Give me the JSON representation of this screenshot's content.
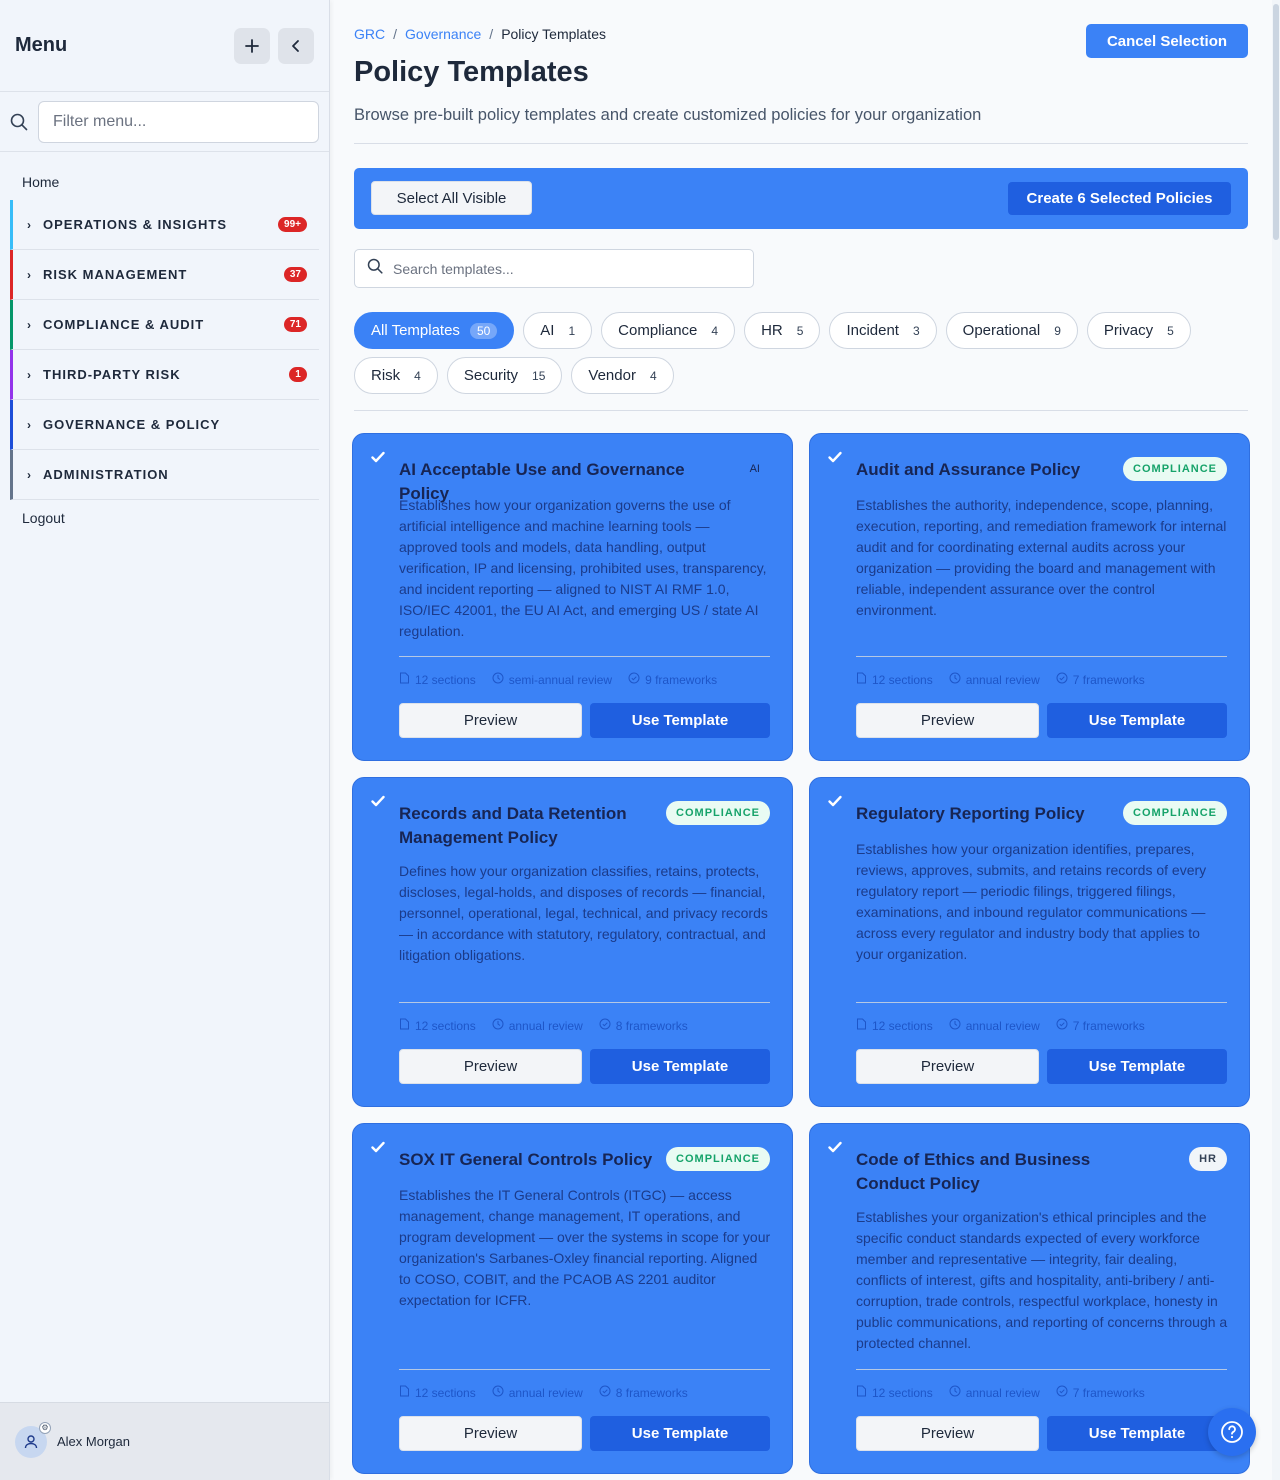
{
  "sidebar": {
    "title": "Menu",
    "add_icon": "plus-icon",
    "collapse_icon": "chevron-left-icon",
    "filter_placeholder": "Filter menu...",
    "home": "Home",
    "sections": [
      {
        "label": "OPERATIONS & INSIGHTS",
        "badge": "99+",
        "color": "#38bdf8"
      },
      {
        "label": "RISK MANAGEMENT",
        "badge": "37",
        "color": "#dc2626"
      },
      {
        "label": "COMPLIANCE & AUDIT",
        "badge": "71",
        "color": "#059669"
      },
      {
        "label": "THIRD-PARTY RISK",
        "badge": "1",
        "color": "#9333ea"
      },
      {
        "label": "GOVERNANCE & POLICY",
        "badge": "",
        "color": "#1d4ed8"
      },
      {
        "label": "ADMINISTRATION",
        "badge": "",
        "color": "#64748b"
      }
    ],
    "logout": "Logout",
    "user_name": "Alex Morgan"
  },
  "breadcrumb": {
    "items": [
      "GRC",
      "Governance"
    ],
    "sep": "/",
    "current": "Policy Templates"
  },
  "header": {
    "cancel_label": "Cancel Selection",
    "title": "Policy Templates",
    "subtitle": "Browse pre-built policy templates and create customized policies for your organization"
  },
  "selection": {
    "select_all_label": "Select All Visible",
    "create_label": "Create 6 Selected Policies"
  },
  "search": {
    "placeholder": "Search templates..."
  },
  "filters": [
    {
      "label": "All Templates",
      "count": "50",
      "active": true
    },
    {
      "label": "AI",
      "count": "1"
    },
    {
      "label": "Compliance",
      "count": "4"
    },
    {
      "label": "HR",
      "count": "5"
    },
    {
      "label": "Incident",
      "count": "3"
    },
    {
      "label": "Operational",
      "count": "9"
    },
    {
      "label": "Privacy",
      "count": "5"
    },
    {
      "label": "Risk",
      "count": "4"
    },
    {
      "label": "Security",
      "count": "15"
    },
    {
      "label": "Vendor",
      "count": "4"
    }
  ],
  "cards": [
    {
      "title": "AI Acceptable Use and Governance Policy",
      "tag": "AI",
      "description": "Establishes how your organization governs the use of artificial intelligence and machine learning tools — approved tools and models, data handling, output verification, IP and licensing, prohibited uses, transparency, and incident reporting — aligned to NIST AI RMF 1.0, ISO/IEC 42001, the EU AI Act, and emerging US / state AI regulation.",
      "sections": "12 sections",
      "review": "semi-annual review",
      "frameworks": "9 frameworks",
      "preview_label": "Preview",
      "use_label": "Use Template",
      "selected": true
    },
    {
      "title": "Audit and Assurance Policy",
      "tag": "COMPLIANCE",
      "description": "Establishes the authority, independence, scope, planning, execution, reporting, and remediation framework for internal audit and for coordinating external audits across your organization — providing the board and management with reliable, independent assurance over the control environment.",
      "sections": "12 sections",
      "review": "annual review",
      "frameworks": "7 frameworks",
      "preview_label": "Preview",
      "use_label": "Use Template",
      "selected": true
    },
    {
      "title": "Records and Data Retention Management Policy",
      "tag": "COMPLIANCE",
      "description": "Defines how your organization classifies, retains, protects, discloses, legal-holds, and disposes of records — financial, personnel, operational, legal, technical, and privacy records — in accordance with statutory, regulatory, contractual, and litigation obligations.",
      "sections": "12 sections",
      "review": "annual review",
      "frameworks": "8 frameworks",
      "preview_label": "Preview",
      "use_label": "Use Template",
      "selected": true
    },
    {
      "title": "Regulatory Reporting Policy",
      "tag": "COMPLIANCE",
      "description": "Establishes how your organization identifies, prepares, reviews, approves, submits, and retains records of every regulatory report — periodic filings, triggered filings, examinations, and inbound regulator communications — across every regulator and industry body that applies to your organization.",
      "sections": "12 sections",
      "review": "annual review",
      "frameworks": "7 frameworks",
      "preview_label": "Preview",
      "use_label": "Use Template",
      "selected": true
    },
    {
      "title": "SOX IT General Controls Policy",
      "tag": "COMPLIANCE",
      "description": "Establishes the IT General Controls (ITGC) — access management, change management, IT operations, and program development — over the systems in scope for your organization's Sarbanes-Oxley financial reporting. Aligned to COSO, COBIT, and the PCAOB AS 2201 auditor expectation for ICFR.",
      "sections": "12 sections",
      "review": "annual review",
      "frameworks": "8 frameworks",
      "preview_label": "Preview",
      "use_label": "Use Template",
      "selected": true
    },
    {
      "title": "Code of Ethics and Business Conduct Policy",
      "tag": "HR",
      "description": "Establishes your organization's ethical principles and the specific conduct standards expected of every workforce member and representative — integrity, fair dealing, conflicts of interest, gifts and hospitality, anti-bribery / anti-corruption, trade controls, respectful workplace, honesty in public communications, and reporting of concerns through a protected channel.",
      "sections": "12 sections",
      "review": "annual review",
      "frameworks": "7 frameworks",
      "preview_label": "Preview",
      "use_label": "Use Template",
      "selected": true
    }
  ],
  "help_icon": "help-icon"
}
